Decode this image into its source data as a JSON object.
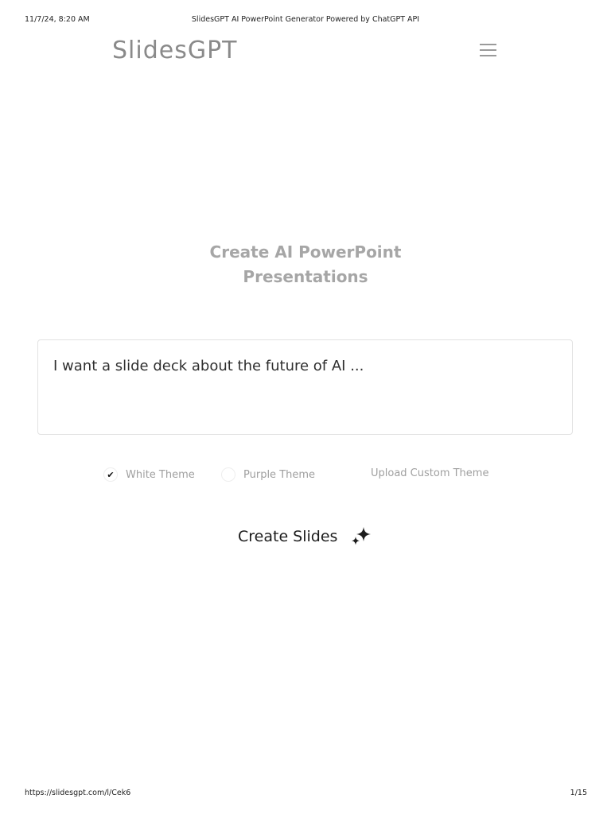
{
  "print": {
    "datetime": "11/7/24, 8:20 AM",
    "title": "SlidesGPT AI PowerPoint Generator Powered by ChatGPT API",
    "url": "https://slidesgpt.com/l/Cek6",
    "page_number": "1/15"
  },
  "nav": {
    "logo": "SlidesGPT",
    "menu_icon": "hamburger-menu-icon"
  },
  "hero": {
    "title_line1": "Create AI PowerPoint",
    "title_line2": "Presentations"
  },
  "prompt": {
    "placeholder": "I want a slide deck about the future of AI ...",
    "value": ""
  },
  "themes": {
    "options": [
      {
        "label": "White Theme",
        "selected": true
      },
      {
        "label": "Purple Theme",
        "selected": false
      }
    ],
    "upload_label": "Upload Custom Theme"
  },
  "create": {
    "label": "Create Slides",
    "icon": "sparkles-icon"
  }
}
